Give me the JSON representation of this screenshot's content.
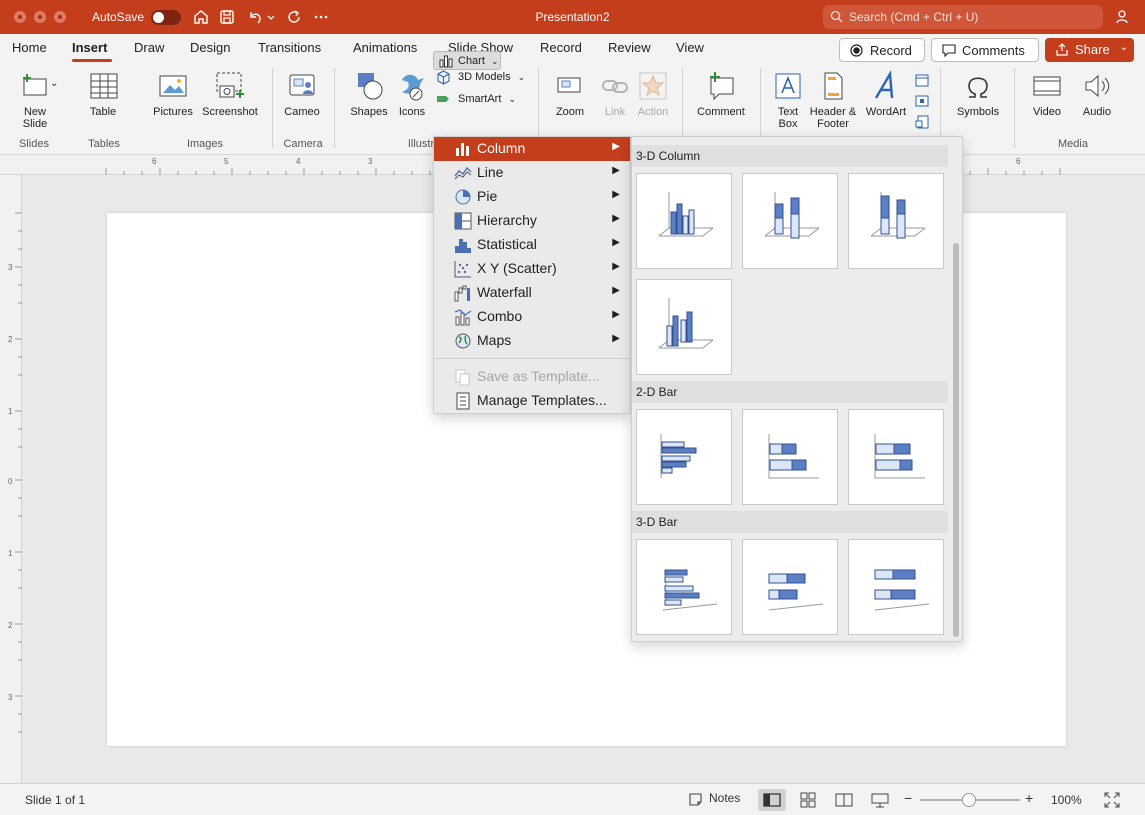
{
  "titlebar": {
    "autosave": "AutoSave",
    "doc_title": "Presentation2",
    "search_placeholder": "Search (Cmd + Ctrl + U)"
  },
  "tabs": [
    "Home",
    "Insert",
    "Draw",
    "Design",
    "Transitions",
    "Animations",
    "Slide Show",
    "Record",
    "Review",
    "View"
  ],
  "header_buttons": {
    "record": "Record",
    "comments": "Comments",
    "share": "Share"
  },
  "ribbon": {
    "buttons": {
      "new_slide": "New\nSlide",
      "table": "Table",
      "pictures": "Pictures",
      "screenshot": "Screenshot",
      "cameo": "Cameo",
      "shapes": "Shapes",
      "icons": "Icons",
      "models_3d": "3D Models",
      "smartart": "SmartArt",
      "chart": "Chart",
      "zoom": "Zoom",
      "link": "Link",
      "action": "Action",
      "comment": "Comment",
      "text_box": "Text\nBox",
      "header_footer": "Header &\nFooter",
      "wordart": "WordArt",
      "symbols": "Symbols",
      "video": "Video",
      "audio": "Audio"
    },
    "groups": {
      "slides": "Slides",
      "tables": "Tables",
      "images": "Images",
      "camera": "Camera",
      "illustrations": "Illustr",
      "media": "Media"
    }
  },
  "ruler": {
    "h_labels": [
      "6",
      "5",
      "4",
      "3",
      "6"
    ],
    "v_labels": [
      "3",
      "2",
      "1",
      "0",
      "1",
      "2",
      "3"
    ]
  },
  "chart_menu": {
    "items": [
      "Column",
      "Line",
      "Pie",
      "Hierarchy",
      "Statistical",
      "X Y (Scatter)",
      "Waterfall",
      "Combo",
      "Maps"
    ],
    "selected": "Column",
    "save_template": "Save as Template...",
    "manage_templates": "Manage Templates..."
  },
  "gallery": {
    "sections": [
      "3-D Column",
      "2-D Bar",
      "3-D Bar"
    ]
  },
  "status": {
    "slide": "Slide 1 of 1",
    "notes": "Notes",
    "zoom": "100%"
  },
  "colors": {
    "accent": "#c43e1c",
    "chart_blue": "#5b7fc4",
    "chart_light": "#dbe6f7"
  }
}
